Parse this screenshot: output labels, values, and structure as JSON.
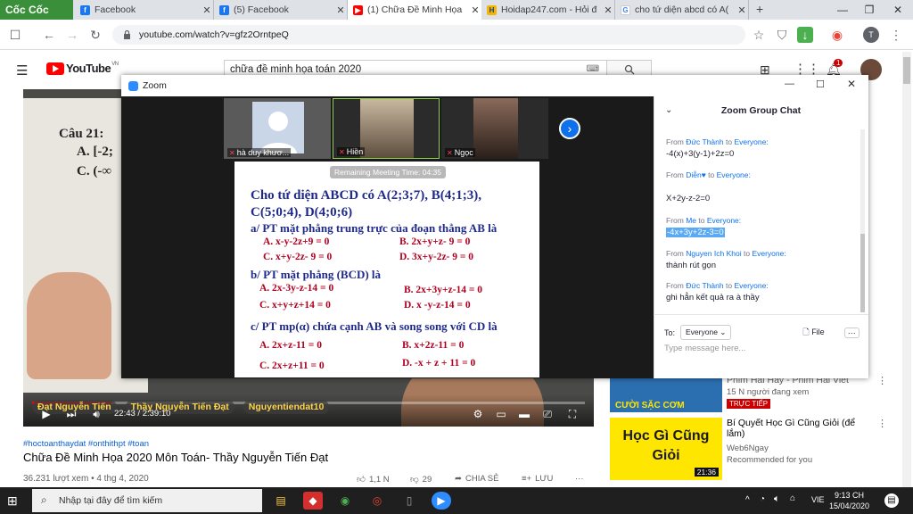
{
  "browser": {
    "brand": "Cốc Cốc",
    "tabs": [
      {
        "title": "Facebook",
        "icon": "facebook-icon"
      },
      {
        "title": "(5) Facebook",
        "icon": "facebook-icon"
      },
      {
        "title": "(1) Chữa Đề Minh Họa",
        "icon": "youtube-icon"
      },
      {
        "title": "Hoidap247.com - Hỏi đ",
        "icon": "hoidap-icon"
      },
      {
        "title": "cho tứ diện abcd có A(",
        "icon": "google-icon"
      }
    ],
    "new_tab": "+",
    "url": "youtube.com/watch?v=gfz2OrntpeQ",
    "profile_initial": "T"
  },
  "youtube": {
    "logo": "YouTube",
    "region": "VN",
    "search_value": "chữa đề minh họa toán 2020",
    "notification_count": "1",
    "video": {
      "time": "22:43 / 2:39:10",
      "overlay_name": "Đạt Nguyễn Tiến",
      "overlay_fb": "Thầy Nguyễn Tiến Đạt",
      "overlay_ig": "Nguyentiendat10",
      "progress_fraction": 0.143,
      "board_lines": [
        "Câu 21:",
        "A. [-2;",
        "C. (-∞"
      ]
    },
    "hashtags": "#hoctoanthaydat #onthithpt #toan",
    "title": "Chữa Đề Minh Họa 2020 Môn Toán- Thầy Nguyễn Tiến Đạt",
    "views": "36.231 lượt xem • 4 thg 4, 2020",
    "likes": "1,1 N",
    "dislikes": "29",
    "share": "CHIA SẺ",
    "save": "LƯU",
    "recommendations": [
      {
        "title": "Phim Hai Hay - Phim Hai Viet",
        "channel": "",
        "meta": "15 N người đang xem",
        "badge": "TRỰC TIẾP",
        "thumb_text": "CƯỜI SẶC CƠM"
      },
      {
        "title": "Bí Quyết Học Gì Cũng Giỏi (để lắm)",
        "channel": "Web6Ngay",
        "meta": "Recommended for you",
        "duration": "21:36",
        "thumb_text": "Học Gì Cũng Giỏi"
      }
    ]
  },
  "zoom": {
    "title": "Zoom",
    "participants": [
      "hà duy khươ...",
      "Hiền",
      "Ngọc"
    ],
    "remaining": "Remaining Meeting Time: 04:35",
    "slide": {
      "line1": "Cho tứ diện ABCD có A(2;3;7), B(4;1;3),",
      "line2": "C(5;0;4), D(4;0;6)",
      "qa": "a/ PT mặt phẳng trung trực của đoạn thẳng AB là",
      "qa_opts": [
        "A. x-y-2z+9 = 0",
        "B.  2x+y+z- 9 = 0",
        "C. x+y-2z- 9 = 0",
        "D. 3x+y-2z- 9 = 0"
      ],
      "qb": "b/ PT mặt phẳng (BCD) là",
      "qb_opts": [
        "A.  2x-3y-z-14 = 0",
        "B.  2x+3y+z-14 = 0",
        "C. x+y+z+14 = 0",
        "D.  x -y-z-14 = 0"
      ],
      "qc": "c/ PT mp(α) chứa cạnh AB và song song với CD là",
      "qc_opts": [
        "A.  2x+z-11 = 0",
        "B.  x+2z-11 = 0",
        "C.  2x+z+11 = 0",
        "D. -x + z + 11 = 0"
      ]
    },
    "chat": {
      "header": "Zoom Group Chat",
      "messages": [
        {
          "from": "From",
          "who": "Đức Thành",
          "to": "to",
          "target": "Everyone:",
          "text": "-4(x)+3(y-1)+2z=0"
        },
        {
          "from": "From",
          "who": "Diễn♥",
          "to": "to",
          "target": "Everyone:",
          "text": "X+2y-z-2=0"
        },
        {
          "from": "From",
          "who": "Me",
          "to": "to",
          "target": "Everyone:",
          "text": "-4x+3y+2z-3=0"
        },
        {
          "from": "From",
          "who": "Nguyen Ich Khoi",
          "to": "to",
          "target": "Everyone:",
          "text": "thành rút gọn"
        },
        {
          "from": "From",
          "who": "Đức Thành",
          "to": "to",
          "target": "Everyone:",
          "text": "ghi hẳn kết quả ra à thầy"
        }
      ],
      "to_label": "To:",
      "to_value": "Everyone",
      "file_label": "File",
      "placeholder": "Type message here..."
    }
  },
  "taskbar": {
    "search_placeholder": "Nhập tại đây để tìm kiếm",
    "lang": "VIE",
    "time": "9:13 CH",
    "date": "15/04/2020"
  }
}
